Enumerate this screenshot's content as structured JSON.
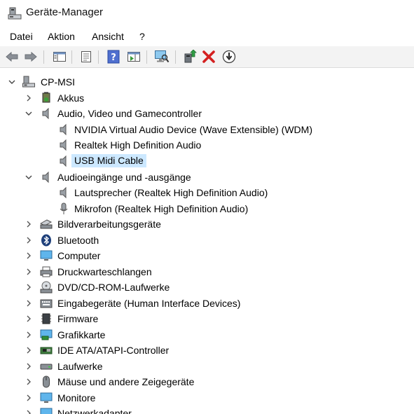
{
  "window": {
    "title": "Geräte-Manager"
  },
  "menu": [
    "Datei",
    "Aktion",
    "Ansicht",
    "?"
  ],
  "toolbar": {
    "buttons": [
      "back-icon",
      "forward-icon",
      "show-hide-console-tree-icon",
      "properties-icon",
      "help-icon",
      "action-pane-icon",
      "scan-hardware-icon",
      "update-driver-icon",
      "uninstall-icon",
      "disable-device-icon"
    ]
  },
  "tree": {
    "root": "CP-MSI",
    "items": [
      {
        "label": "Akkus"
      },
      {
        "label": "Audio, Video und Gamecontroller",
        "children": [
          "NVIDIA Virtual Audio Device (Wave Extensible) (WDM)",
          "Realtek High Definition Audio",
          "USB Midi Cable"
        ],
        "selected_child": "USB Midi Cable"
      },
      {
        "label": "Audioeingänge und -ausgänge",
        "children": [
          "Lautsprecher (Realtek High Definition Audio)",
          "Mikrofon (Realtek High Definition Audio)"
        ]
      },
      {
        "label": "Bildverarbeitungsgeräte"
      },
      {
        "label": "Bluetooth"
      },
      {
        "label": "Computer"
      },
      {
        "label": "Druckwarteschlangen"
      },
      {
        "label": "DVD/CD-ROM-Laufwerke"
      },
      {
        "label": "Eingabegeräte (Human Interface Devices)"
      },
      {
        "label": "Firmware"
      },
      {
        "label": "Grafikkarte"
      },
      {
        "label": "IDE ATA/ATAPI-Controller"
      },
      {
        "label": "Laufwerke"
      },
      {
        "label": "Mäuse und andere Zeigegeräte"
      },
      {
        "label": "Monitore"
      },
      {
        "label": "Netzwerkadapter"
      }
    ]
  },
  "colors": {
    "selection": "#cce8ff",
    "toolbar_bg": "#f3f3f3"
  }
}
